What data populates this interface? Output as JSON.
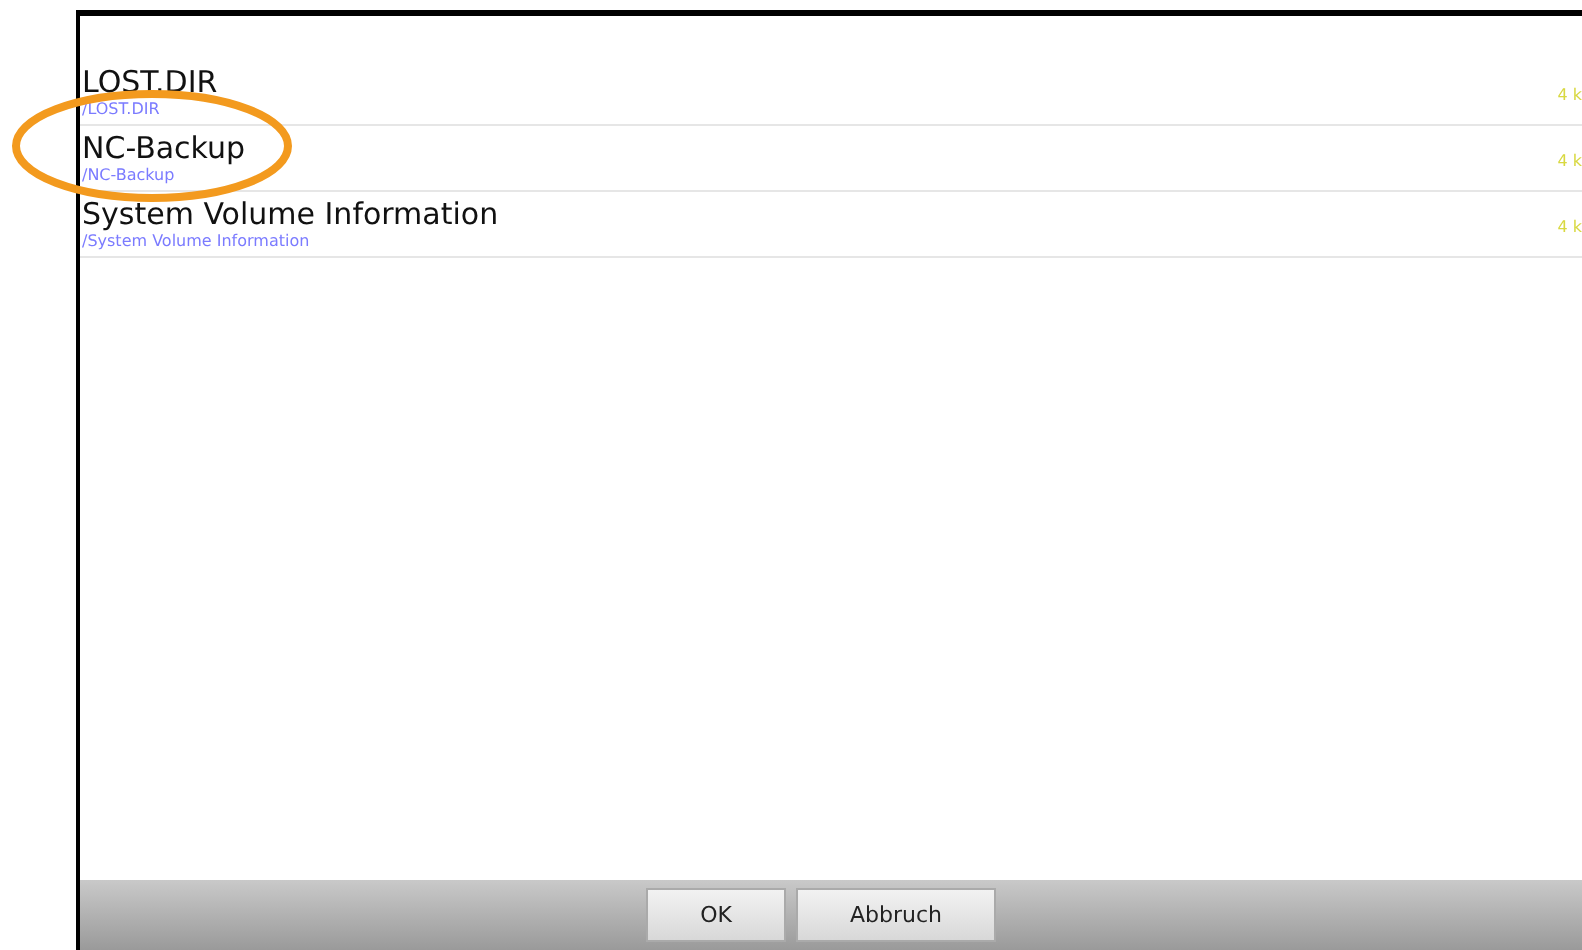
{
  "files": [
    {
      "name": "LOST.DIR",
      "path": "/LOST.DIR",
      "size": "4 k"
    },
    {
      "name": "NC-Backup",
      "path": "/NC-Backup",
      "size": "4 k"
    },
    {
      "name": "System Volume Information",
      "path": "/System Volume Information",
      "size": "4 k"
    }
  ],
  "buttons": [
    "OK",
    "Abbruch"
  ]
}
